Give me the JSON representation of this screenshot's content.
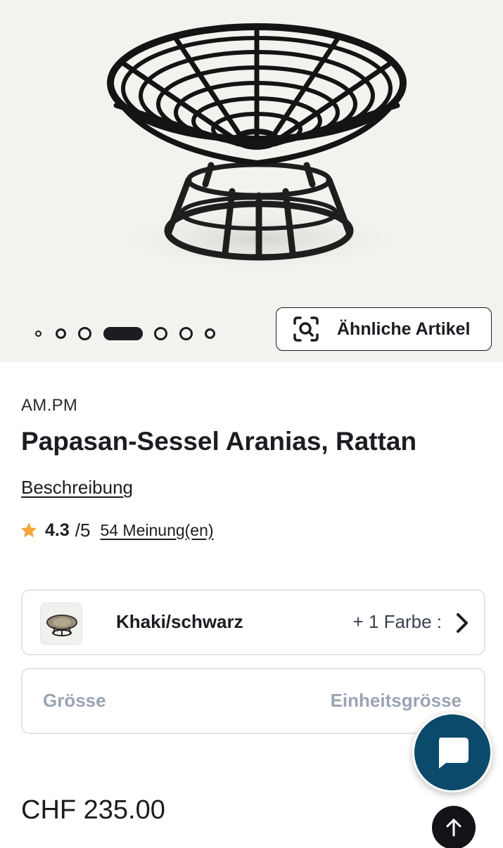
{
  "gallery": {
    "slide_count": 7,
    "active_slide": 4,
    "similar_button_label": "Ähnliche Artikel"
  },
  "product": {
    "brand": "AM.PM",
    "title": "Papasan-Sessel Aranias, Rattan",
    "description_link": "Beschreibung",
    "rating": {
      "score": "4.3",
      "out_of": "/5",
      "reviews_label": "54 Meinung(en)"
    },
    "variant": {
      "color_name": "Khaki/schwarz",
      "more_colors": "+ 1 Farbe :"
    },
    "size": {
      "label": "Grösse",
      "value": "Einheitsgrösse"
    },
    "price": "CHF 235.00"
  },
  "colors": {
    "accent_chat": "#0b4a6b",
    "star": "#f2a93b",
    "muted_text": "#9aa3b3"
  },
  "icons": {
    "similar": "image-search-icon",
    "star": "star-icon",
    "chevron": "chevron-right-icon",
    "chat": "chat-bubble-icon",
    "top": "arrow-up-icon"
  }
}
